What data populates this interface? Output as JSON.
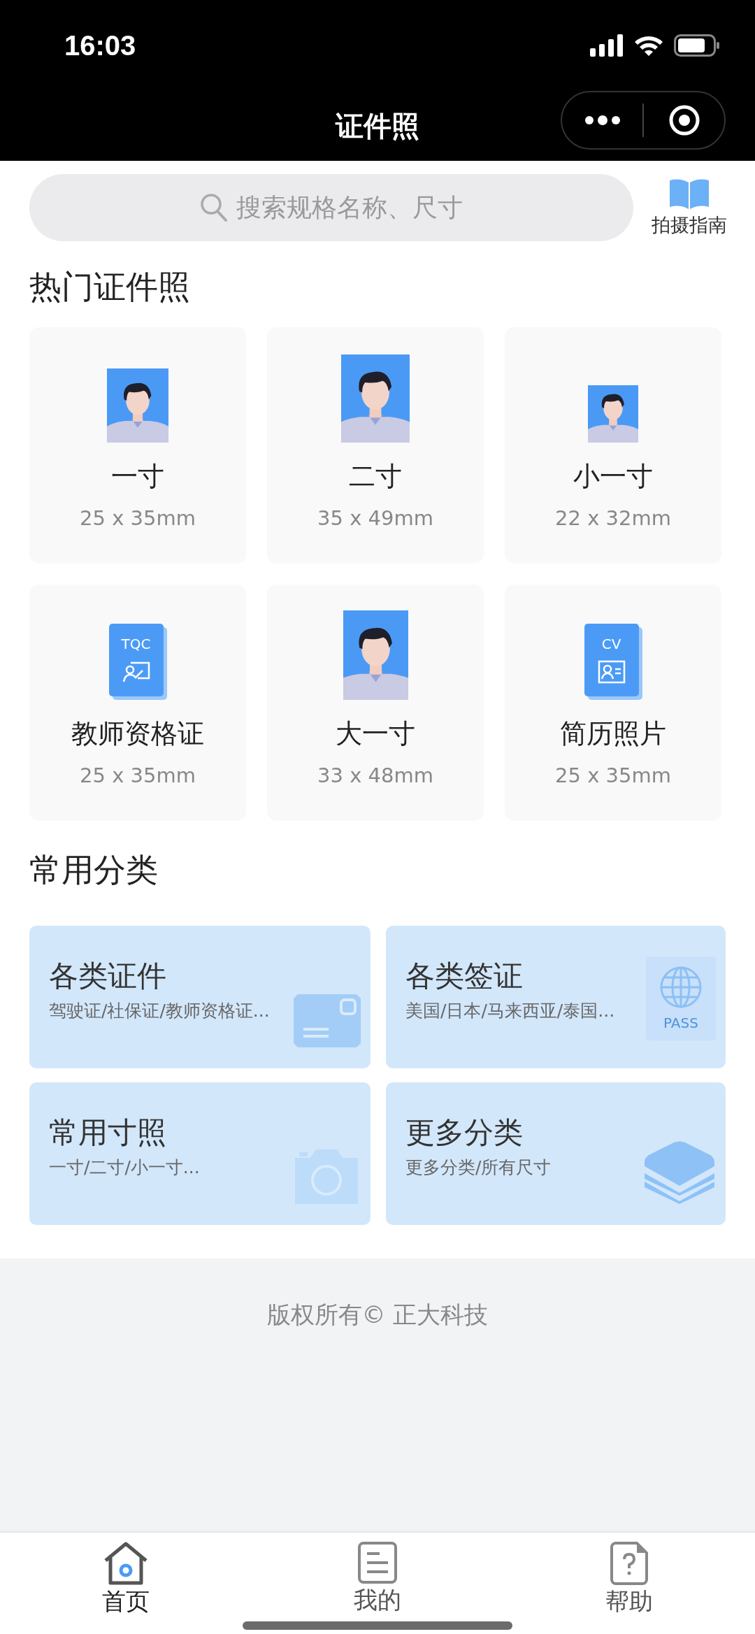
{
  "status_bar": {
    "time": "16:03"
  },
  "nav_bar": {
    "title": "证件照"
  },
  "search": {
    "placeholder": "搜索规格名称、尺寸"
  },
  "guide": {
    "label": "拍摄指南"
  },
  "hot_section": {
    "title": "热门证件照"
  },
  "specs": [
    {
      "kind": "standard",
      "name": "一寸",
      "size": "25 x 35mm"
    },
    {
      "kind": "large",
      "name": "二寸",
      "size": "35 x 49mm"
    },
    {
      "kind": "small",
      "name": "小一寸",
      "size": "22 x 32mm"
    },
    {
      "kind": "teacher",
      "cover_text": "TQC",
      "name": "教师资格证",
      "size": "25 x 35mm"
    },
    {
      "kind": "tall",
      "name": "大一寸",
      "size": "33 x 48mm"
    },
    {
      "kind": "resume",
      "cover_text": "CV",
      "name": "简历照片",
      "size": "25 x 35mm"
    }
  ],
  "category_section": {
    "title": "常用分类"
  },
  "categories": [
    {
      "kind": "card",
      "title": "各类证件",
      "subtitle": "驾驶证/社保证/教师资格证..."
    },
    {
      "kind": "passport",
      "title": "各类签证",
      "subtitle": "美国/日本/马来西亚/泰国...",
      "badge_text": "PASS"
    },
    {
      "kind": "camera",
      "title": "常用寸照",
      "subtitle": "一寸/二寸/小一寸..."
    },
    {
      "kind": "layers",
      "title": "更多分类",
      "subtitle": "更多分类/所有尺寸"
    }
  ],
  "footer": {
    "text": "版权所有© 正大科技"
  },
  "tab_bar": [
    {
      "kind": "home",
      "label": "首页",
      "selected": true
    },
    {
      "kind": "list",
      "label": "我的",
      "selected": false
    },
    {
      "kind": "help",
      "label": "帮助",
      "selected": false
    }
  ]
}
